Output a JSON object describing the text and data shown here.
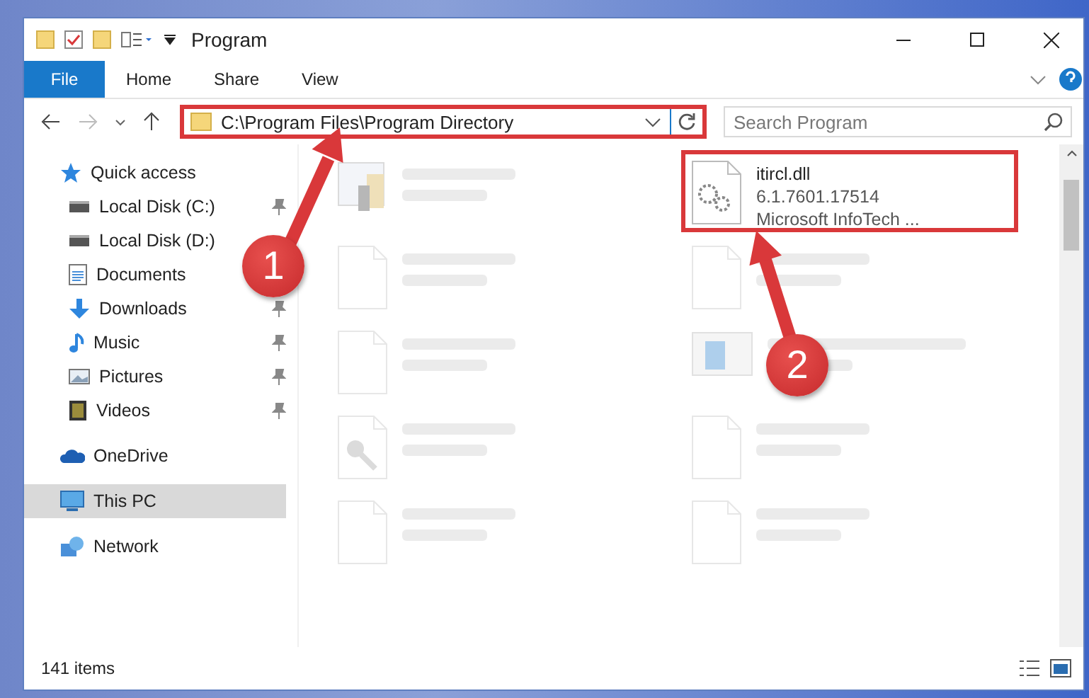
{
  "window": {
    "title": "Program"
  },
  "ribbon_tabs": [
    {
      "label": "File",
      "kind": "file"
    },
    {
      "label": "Home",
      "kind": "tab"
    },
    {
      "label": "Share",
      "kind": "tab"
    },
    {
      "label": "View",
      "kind": "tab"
    }
  ],
  "address": {
    "path": "C:\\Program Files\\Program Directory",
    "highlighted": true
  },
  "search": {
    "placeholder": "Search Program"
  },
  "sidebar": {
    "items": [
      {
        "label": "Quick access",
        "kind": "star",
        "selected": false,
        "children": [
          {
            "label": "Local Disk (C:)",
            "kind": "disk",
            "pinned": true
          },
          {
            "label": "Local Disk (D:)",
            "kind": "disk",
            "pinned": false
          },
          {
            "label": "Documents",
            "kind": "document",
            "pinned": false
          },
          {
            "label": "Downloads",
            "kind": "download",
            "pinned": true
          },
          {
            "label": "Music",
            "kind": "music",
            "pinned": true
          },
          {
            "label": "Pictures",
            "kind": "picture",
            "pinned": true
          },
          {
            "label": "Videos",
            "kind": "video",
            "pinned": true
          }
        ]
      },
      {
        "label": "OneDrive",
        "kind": "cloud",
        "selected": false
      },
      {
        "label": "This PC",
        "kind": "pc",
        "selected": true
      },
      {
        "label": "Network",
        "kind": "network",
        "selected": false
      }
    ]
  },
  "files": [
    {
      "kind": "app",
      "blurred": true,
      "highlighted": false
    },
    {
      "name": "itircl.dll",
      "lines": [
        "6.1.7601.17514",
        "Microsoft InfoTech ..."
      ],
      "kind": "gears",
      "blurred": false,
      "highlighted": true
    },
    {
      "kind": "blank",
      "blurred": true,
      "highlighted": false
    },
    {
      "kind": "blank",
      "blurred": true,
      "highlighted": false
    },
    {
      "kind": "blank",
      "blurred": true,
      "highlighted": false
    },
    {
      "kind": "window",
      "blurred": true,
      "highlighted": false
    },
    {
      "kind": "key",
      "blurred": true,
      "highlighted": false
    },
    {
      "kind": "blank",
      "blurred": true,
      "highlighted": false
    },
    {
      "kind": "blank",
      "blurred": true,
      "highlighted": false
    },
    {
      "kind": "blank",
      "blurred": true,
      "highlighted": false
    }
  ],
  "status_bar": {
    "count": "141 items"
  },
  "annotations": [
    {
      "label": "1"
    },
    {
      "label": "2"
    }
  ]
}
